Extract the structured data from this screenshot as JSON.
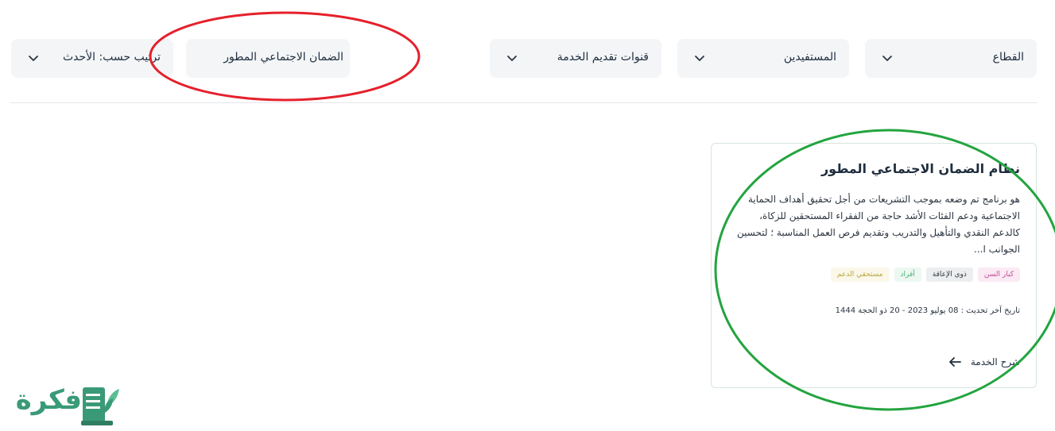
{
  "filters": {
    "sector": "القطاع",
    "beneficiaries": "المستفيدين",
    "channels": "قنوات تقديم الخدمة",
    "search": "الضمان الاجتماعي المطور",
    "sort": "ترتيب حسب: الأحدث"
  },
  "card": {
    "title": "نظام الضمان الاجتماعي المطور",
    "description": "هو برنامج تم وضعه بموجب التشريعات من أجل تحقيق أهداف الحماية الاجتماعية ودعم الفئات الأشد حاجة من الفقراء المستحقين للزكاة، كالدعم النقدي والتأهيل والتدريب وتقديم فرص العمل المناسبة ؛ لتحسين الجوانب ا...",
    "tags": [
      "كبار السن",
      "ذوي الإعاقة",
      "أفراد",
      "مستحقي الدعم"
    ],
    "last_updated": "تاريخ آخر تحديث : 08 يوليو 2023 - 20 ذو الحجة 1444",
    "explain_label": "شرح الخدمة"
  },
  "logo": {
    "text": "فكرة"
  },
  "colors": {
    "red_annotation": "#e5202b",
    "green_annotation": "#23a43f",
    "brand": "#3a9a78"
  },
  "icons": {
    "chevron": "chevron-down-icon",
    "arrow": "arrow-left-icon",
    "logo_book": "book-leaf-icon"
  }
}
